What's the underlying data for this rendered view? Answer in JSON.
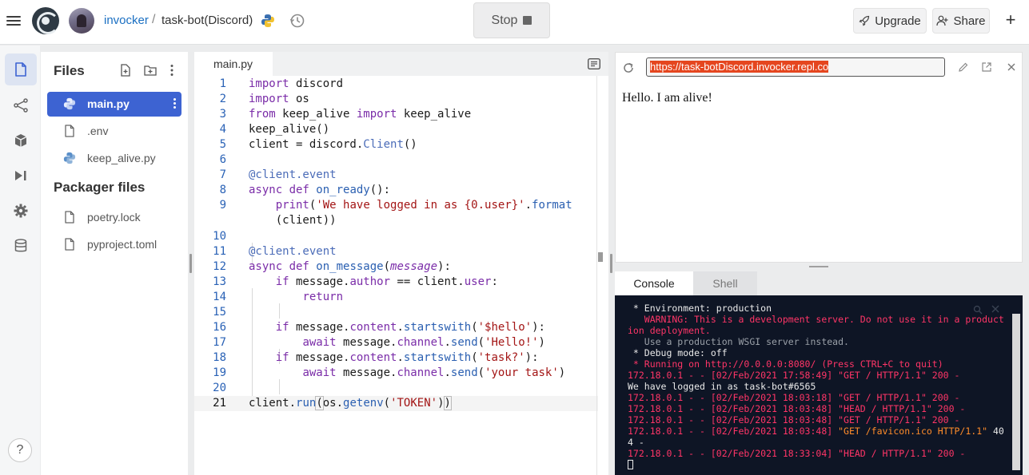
{
  "header": {
    "owner": "invocker",
    "separator": "/",
    "project": "task-bot(Discord)",
    "stop_label": "Stop",
    "upgrade_label": "Upgrade",
    "share_label": "Share"
  },
  "files_panel": {
    "title": "Files",
    "items": [
      {
        "name": "main.py",
        "icon": "python-icon",
        "active": true
      },
      {
        "name": ".env",
        "icon": "file-icon",
        "active": false
      },
      {
        "name": "keep_alive.py",
        "icon": "python-icon",
        "active": false
      }
    ],
    "packager_title": "Packager files",
    "packager_items": [
      {
        "name": "poetry.lock",
        "icon": "file-icon"
      },
      {
        "name": "pyproject.toml",
        "icon": "file-icon"
      }
    ]
  },
  "editor": {
    "tab_label": "main.py",
    "line_numbers": [
      "1",
      "2",
      "3",
      "4",
      "5",
      "6",
      "7",
      "8",
      "9",
      "10",
      "11",
      "12",
      "13",
      "14",
      "15",
      "16",
      "17",
      "18",
      "19",
      "20",
      "21"
    ],
    "active_line": "21"
  },
  "webview": {
    "url": "https://task-botDiscord.invocker.repl.co",
    "body_text": "Hello. I am alive!"
  },
  "console_tabs": {
    "console_label": "Console",
    "shell_label": "Shell"
  },
  "console": {
    "lines": [
      " * Environment: production",
      "   WARNING: This is a development server. Do not use it in a product",
      "ion deployment.",
      "   Use a production WSGI server instead.",
      " * Debug mode: off",
      " * Running on http://0.0.0.0:8080/ (Press CTRL+C to quit)",
      "172.18.0.1 - - [02/Feb/2021 17:58:49] \"GET / HTTP/1.1\" 200 -",
      "We have logged in as task-bot#6565",
      "172.18.0.1 - - [02/Feb/2021 18:03:18] \"GET / HTTP/1.1\" 200 -",
      "172.18.0.1 - - [02/Feb/2021 18:03:48] \"HEAD / HTTP/1.1\" 200 -",
      "172.18.0.1 - - [02/Feb/2021 18:03:48] \"GET / HTTP/1.1\" 200 -",
      "172.18.0.1 - - [02/Feb/2021 18:03:48] ",
      "\"GET /favicon.ico HTTP/1.1\"",
      " 40",
      "4 -",
      "172.18.0.1 - - [02/Feb/2021 18:33:04] \"HEAD / HTTP/1.1\" 200 -"
    ]
  },
  "help_label": "?",
  "colors": {
    "accent": "#3d63d2",
    "console_bg": "#0e1525",
    "console_red": "#ff3567",
    "console_orange": "#ff8c2a",
    "url_highlight": "#e5461f"
  }
}
